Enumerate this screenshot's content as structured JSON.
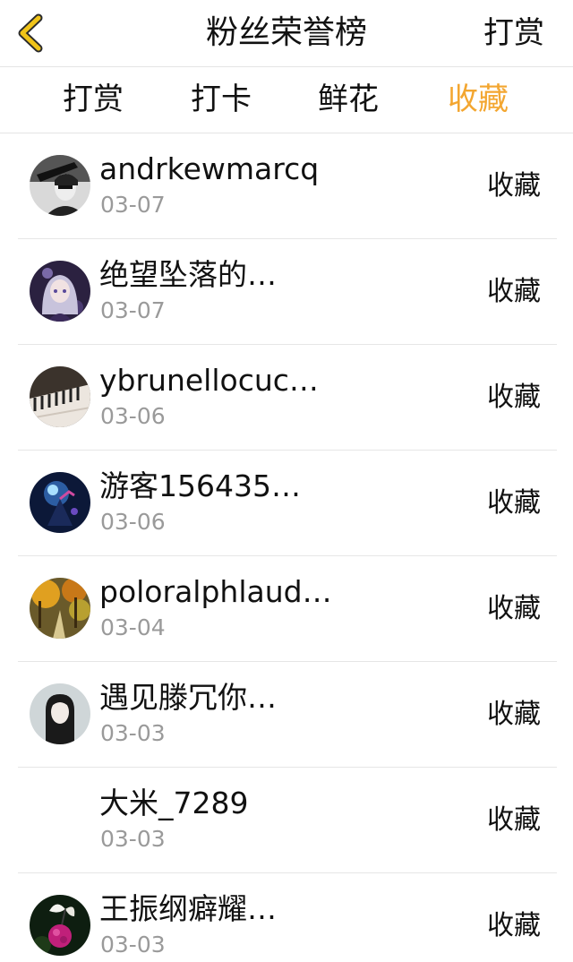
{
  "header": {
    "title": "粉丝荣誉榜",
    "right_action": "打赏"
  },
  "tabs": [
    {
      "label": "打赏",
      "active": false
    },
    {
      "label": "打卡",
      "active": false
    },
    {
      "label": "鲜花",
      "active": false
    },
    {
      "label": "收藏",
      "active": true
    }
  ],
  "colors": {
    "accent": "#f3a630",
    "text": "#111111",
    "muted": "#9a9a9a",
    "divider": "#e6e6e6"
  },
  "rows": [
    {
      "name": "andrkewmarcq",
      "date": "03-07",
      "action": "收藏",
      "avatar": "bw-portrait"
    },
    {
      "name": "绝望坠落的…",
      "date": "03-07",
      "action": "收藏",
      "avatar": "anime-girl"
    },
    {
      "name": "ybrunellocuc…",
      "date": "03-06",
      "action": "收藏",
      "avatar": "piano-keys"
    },
    {
      "name": "游客156435…",
      "date": "03-06",
      "action": "收藏",
      "avatar": "fantasy-blue"
    },
    {
      "name": "poloralphlaud…",
      "date": "03-04",
      "action": "收藏",
      "avatar": "autumn-path"
    },
    {
      "name": "遇见滕冗你…",
      "date": "03-03",
      "action": "收藏",
      "avatar": "dark-hair-girl"
    },
    {
      "name": "大米_7289",
      "date": "03-03",
      "action": "收藏",
      "avatar": "none"
    },
    {
      "name": "王振纲癖耀…",
      "date": "03-03",
      "action": "收藏",
      "avatar": "butterfly-flower"
    }
  ]
}
